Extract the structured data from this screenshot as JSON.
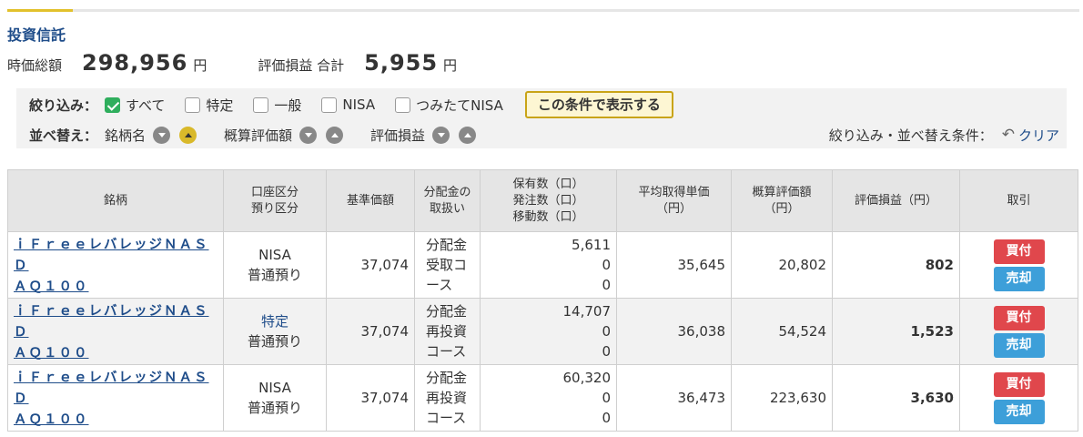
{
  "section": {
    "title": "投資信託"
  },
  "summary": {
    "market_value_label": "時価総額",
    "market_value": "298,956",
    "gain_label": "評価損益 合計",
    "gain_total": "5,955",
    "unit": "円"
  },
  "filter": {
    "label": "絞り込み：",
    "options": [
      {
        "label": "すべて",
        "checked": true
      },
      {
        "label": "特定",
        "checked": false
      },
      {
        "label": "一般",
        "checked": false
      },
      {
        "label": "NISA",
        "checked": false
      },
      {
        "label": "つみたてNISA",
        "checked": false
      }
    ],
    "apply_label": "この条件で表示する"
  },
  "sort": {
    "label": "並べ替え：",
    "groups": [
      {
        "label": "銘柄名",
        "active": "asc"
      },
      {
        "label": "概算評価額",
        "active": ""
      },
      {
        "label": "評価損益",
        "active": ""
      }
    ],
    "condition_label": "絞り込み・並べ替え条件：",
    "clear_label": "クリア"
  },
  "table": {
    "headers": {
      "name": "銘柄",
      "account_1": "口座区分",
      "account_2": "預り区分",
      "base_price": "基準価額",
      "dist_1": "分配金の",
      "dist_2": "取扱い",
      "qty_1": "保有数（口）",
      "qty_2": "発注数（口）",
      "qty_3": "移動数（口）",
      "avg_1": "平均取得単価",
      "avg_2": "（円）",
      "val_1": "概算評価額",
      "val_2": "（円）",
      "gain": "評価損益（円）",
      "trade": "取引"
    },
    "rows": [
      {
        "name_1": "ｉＦｒｅｅレバレッジＮＡＳＤ",
        "name_2": "ＡＱ１００",
        "account": "NISA",
        "deposit": "普通預り",
        "base_price": "37,074",
        "dist_1": "分配金",
        "dist_2": "受取コ",
        "dist_3": "ース",
        "held": "5,611",
        "ordered": "0",
        "moved": "0",
        "avg_cost": "35,645",
        "value": "20,802",
        "gain": "802",
        "buy_label": "買付",
        "sell_label": "売却"
      },
      {
        "name_1": "ｉＦｒｅｅレバレッジＮＡＳＤ",
        "name_2": "ＡＱ１００",
        "account": "特定",
        "deposit": "普通預り",
        "base_price": "37,074",
        "dist_1": "分配金",
        "dist_2": "再投資",
        "dist_3": "コース",
        "held": "14,707",
        "ordered": "0",
        "moved": "0",
        "avg_cost": "36,038",
        "value": "54,524",
        "gain": "1,523",
        "buy_label": "買付",
        "sell_label": "売却"
      },
      {
        "name_1": "ｉＦｒｅｅレバレッジＮＡＳＤ",
        "name_2": "ＡＱ１００",
        "account": "NISA",
        "deposit": "普通預り",
        "base_price": "37,074",
        "dist_1": "分配金",
        "dist_2": "再投資",
        "dist_3": "コース",
        "held": "60,320",
        "ordered": "0",
        "moved": "0",
        "avg_cost": "36,473",
        "value": "223,630",
        "gain": "3,630",
        "buy_label": "買付",
        "sell_label": "売却"
      }
    ]
  },
  "colors": {
    "accent": "#e2c12c",
    "link": "#1f4d8a",
    "checkbox": "#2fae5d",
    "buy": "#e0474c",
    "sell": "#3d9fd9"
  },
  "icons": {
    "checkbox_checked": "check-icon",
    "sort_desc": "sort-desc-icon",
    "sort_asc": "sort-asc-icon",
    "clear": "undo-icon"
  }
}
